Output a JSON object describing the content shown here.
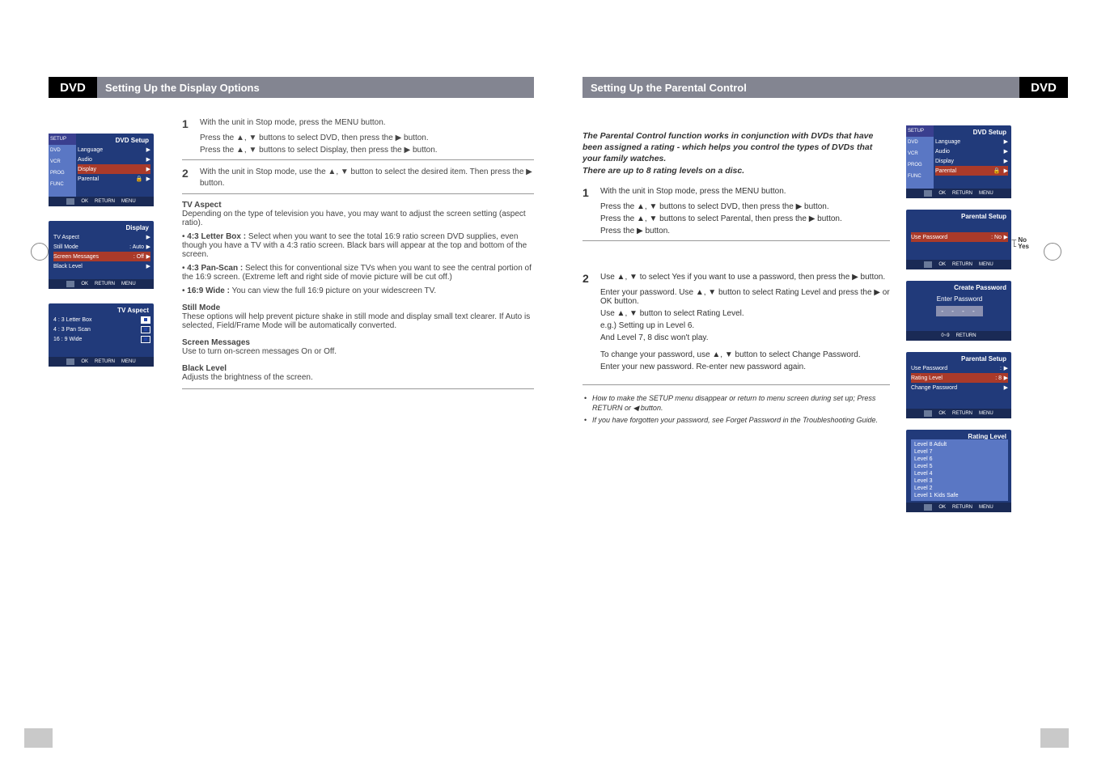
{
  "left": {
    "tag": "DVD",
    "title": "Setting Up the Display Options",
    "osd1": {
      "title": "DVD Setup",
      "sidebar": [
        "SETUP",
        "DVD",
        "VCR",
        "PROG",
        "FUNC"
      ],
      "rows": [
        {
          "lab": "Language",
          "val": "",
          "arr": "▶"
        },
        {
          "lab": "Audio",
          "val": "",
          "arr": "▶"
        },
        {
          "lab": "Display",
          "val": "",
          "arr": "▶",
          "hi": true
        },
        {
          "lab": "Parental",
          "val": "🔒",
          "arr": "▶"
        }
      ],
      "foot": [
        "OK",
        "RETURN",
        "MENU"
      ]
    },
    "osd2": {
      "title": "Display",
      "rows": [
        {
          "lab": "TV Aspect",
          "val": "",
          "arr": "▶"
        },
        {
          "lab": "Still Mode",
          "val": ": Auto",
          "arr": "▶"
        },
        {
          "lab": "Screen Messages",
          "val": ": Off",
          "arr": "▶",
          "hi": true
        },
        {
          "lab": "Black Level",
          "val": "",
          "arr": "▶"
        }
      ],
      "foot": [
        "OK",
        "RETURN",
        "MENU"
      ]
    },
    "osd3": {
      "title": "TV Aspect",
      "rows": [
        {
          "lab": "4 : 3 Letter Box",
          "box": true,
          "sel": true
        },
        {
          "lab": "4 : 3 Pan Scan",
          "box": true
        },
        {
          "lab": "16 : 9 Wide",
          "box": true
        }
      ],
      "foot": [
        "OK",
        "RETURN",
        "MENU"
      ]
    },
    "steps": {
      "s1a": "With the unit in Stop mode, press the MENU button.",
      "s1b": "Press the ▲, ▼ buttons to select DVD, then press the ▶ button.",
      "s1c": "Press the ▲, ▼ buttons to select Display, then press the ▶ button.",
      "s2": "With the unit in Stop mode, use the ▲, ▼ button to select the desired item. Then press the ▶ button.",
      "tvAspectTitle": "TV Aspect",
      "tvAspectBody": "Depending on the type of television you have, you may want to adjust the screen setting (aspect ratio).",
      "lbTitle": "4:3 Letter Box :",
      "lbBody": "Select when you want to see the total 16:9 ratio screen DVD supplies, even though you have a TV with a 4:3 ratio screen. Black bars will appear at the top and bottom of the screen.",
      "psTitle": "4:3 Pan-Scan :",
      "psBody": "Select this for conventional size TVs when you want to see the central portion of the 16:9 screen. (Extreme left and right side of movie picture will be cut off.)",
      "wdTitle": "16:9 Wide :",
      "wdBody": "You can view the full 16:9 picture on your widescreen TV.",
      "stillTitle": "Still Mode",
      "stillBody": "These options will help prevent picture shake in still mode and display small text clearer. If Auto is selected, Field/Frame Mode will be automatically converted.",
      "smTitle": "Screen Messages",
      "smBody": "Use to turn on-screen messages On or Off.",
      "blTitle": "Black Level",
      "blBody": "Adjusts the brightness of the screen."
    }
  },
  "right": {
    "tag": "DVD",
    "title": "Setting Up the Parental Control",
    "intro": "The Parental Control function works in conjunction with DVDs that have been assigned a rating - which helps you control the types of DVDs that your family watches.\nThere are up to 8 rating levels on a disc.",
    "s1": "With the unit in Stop mode, press the MENU button.",
    "s1b": "Press the ▲, ▼ buttons to select DVD, then press the ▶ button.",
    "s1c": "Press the ▲, ▼ buttons to select Parental, then press the ▶ button.",
    "s1d": "Press the ▶ button.",
    "s2a": "Use ▲, ▼ to select Yes if you want to use a password, then press the ▶ button.",
    "s2b": "Enter your password. Use ▲, ▼ button to select Rating Level and press the ▶ or OK button.",
    "s2c": "Use ▲, ▼ button to select Rating Level.",
    "s2d": "e.g.) Setting up in Level 6.",
    "s2e": "And Level 7, 8 disc won't play.",
    "s2f": "To change your password, use ▲, ▼ button to select Change Password.",
    "s2g": "Enter your new password. Re-enter new password again.",
    "notes": [
      "How to make the SETUP menu disappear or return to menu screen during set up; Press RETURN or ◀ button.",
      "If you have forgotten your password, see Forget Password in the Troubleshooting Guide."
    ],
    "osd1": {
      "title": "DVD Setup",
      "sidebar": [
        "SETUP",
        "DVD",
        "VCR",
        "PROG",
        "FUNC"
      ],
      "rows": [
        {
          "lab": "Language",
          "arr": "▶"
        },
        {
          "lab": "Audio",
          "arr": "▶"
        },
        {
          "lab": "Display",
          "arr": "▶"
        },
        {
          "lab": "Parental",
          "val": "🔒",
          "arr": "▶",
          "hi": true
        }
      ],
      "foot": [
        "OK",
        "RETURN",
        "MENU"
      ]
    },
    "osd2": {
      "title": "Parental Setup",
      "rows": [
        {
          "lab": "Use Password",
          "val": ": No",
          "arr": "▶",
          "hi": true
        }
      ],
      "foot": [
        "OK",
        "RETURN",
        "MENU"
      ],
      "callout": [
        "No",
        "Yes"
      ]
    },
    "osd3": {
      "title": "Create Password",
      "label": "Enter Password",
      "pw": "- - - -",
      "foot": [
        "",
        "RETURN",
        ""
      ]
    },
    "osd4": {
      "title": "Parental Setup",
      "rows": [
        {
          "lab": "Use Password",
          "val": ":",
          "arr": "▶"
        },
        {
          "lab": "Rating Level",
          "val": ": 8",
          "arr": "▶",
          "hi": true
        },
        {
          "lab": "Change Password",
          "val": "",
          "arr": "▶"
        }
      ],
      "foot": [
        "OK",
        "RETURN",
        "MENU"
      ]
    },
    "osd5": {
      "title": "Rating Level",
      "levels": [
        "Level 8 Adult",
        "Level 7",
        "Level 6",
        "Level 5",
        "Level 4",
        "Level 3",
        "Level 2",
        "Level 1 Kids Safe"
      ],
      "foot": [
        "OK",
        "RETURN",
        "MENU"
      ]
    }
  }
}
